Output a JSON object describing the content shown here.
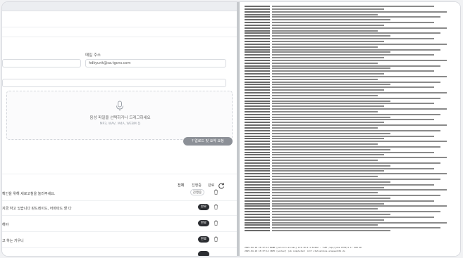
{
  "form": {
    "email_label": "메일 주소",
    "email_value": "hdkyunk@sa.tgcns.com"
  },
  "dropzone": {
    "title": "음성 파일을 선택하거나 드래그하세요",
    "hint": "MP3, WAV, M4A, WEBM 등"
  },
  "upload_button": "업로드 및 요약 요청",
  "filters": {
    "all": "전체",
    "in_progress": "진행중",
    "done": "완료"
  },
  "jobs": [
    {
      "text": "확인을 위해 세로고침을 눌러주세요.",
      "status": "진행중"
    },
    {
      "text": "지금 하고 있습니다 판드레이드, 어마따드 할 다",
      "status": "완료"
    },
    {
      "text": "해야",
      "status": "완료"
    },
    {
      "text": "고 하는 키우니",
      "status": "완료"
    }
  ],
  "log": {
    "line_count": 84,
    "footer_1": "2025-04-18 15:37:13 WARN [uvicorn.access] 172.19.0.1:51242 - \"GET /api/jobs HTTP/1.1\" 200 OK",
    "footer_2": "2025-04-18 15:37:14 INFO [worker] job completed: id=7 status=done elapsed=61.2s"
  }
}
